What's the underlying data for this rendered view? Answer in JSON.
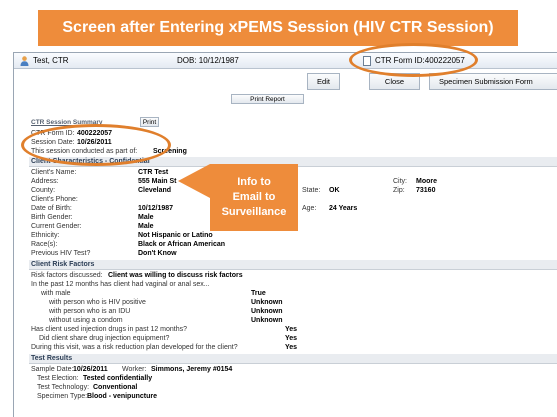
{
  "banner": {
    "title": "Screen after Entering xPEMS Session (HIV CTR Session)"
  },
  "titlebar": {
    "name": "Test, CTR",
    "dob": "DOB: 10/12/1987",
    "form_id": "CTR Form ID:400222057"
  },
  "toolbar": {
    "edit": "Edit",
    "close": "Close",
    "specimen": "Specimen Submission Form",
    "print_report": "Print Report",
    "print": "Print"
  },
  "summary": {
    "title": "CTR Session Summary",
    "form_id_label": "CTR Form ID:",
    "form_id_value": "400222057",
    "session_date_label": "Session Date:",
    "session_date_value": "10/26/2011",
    "conducted_label": "This session conducted as part of:",
    "conducted_value": "Screening"
  },
  "callout": {
    "line1": "Info to",
    "line2": "Email to",
    "line3": "Surveillance"
  },
  "client": {
    "header": "Client Characteristics - Confidential",
    "name_label": "Client's Name:",
    "name": "CTR Test",
    "address_label": "Address:",
    "address": "555 Main St",
    "city_label": "City:",
    "city": "Moore",
    "county_label": "County:",
    "county": "Cleveland",
    "state_label": "State:",
    "state": "OK",
    "zip_label": "Zip:",
    "zip": "73160",
    "phone_label": "Client's Phone:",
    "dob_label": "Date of Birth:",
    "dob": "10/12/1987",
    "age_label": "Age:",
    "age": "24 Years",
    "birth_gender_label": "Birth Gender:",
    "birth_gender": "Male",
    "current_gender_label": "Current Gender:",
    "current_gender": "Male",
    "ethnicity_label": "Ethnicity:",
    "ethnicity": "Not Hispanic or Latino",
    "race_label": "Race(s):",
    "race": "Black or African American",
    "prev_test_label": "Previous HIV Test?",
    "prev_test": "Don't Know"
  },
  "risk": {
    "header": "Client Risk Factors",
    "discussed_label": "Risk factors discussed:",
    "discussed": "Client was willing to discuss risk factors",
    "past12": "In the past 12 months has client had vaginal or anal sex...",
    "with_male": "with male",
    "with_male_val": "True",
    "hiv_pos": "with person who is HIV positive",
    "hiv_pos_val": "Unknown",
    "idu": "with person who is an IDU",
    "idu_val": "Unknown",
    "condom": "without using a condom",
    "condom_val": "Unknown",
    "inj": "Has client used injection drugs in past 12 months?",
    "inj_val": "Yes",
    "share": "Did client share drug injection equipment?",
    "share_val": "Yes",
    "plan": "During this visit, was a risk reduction plan developed for the client?",
    "plan_val": "Yes"
  },
  "results": {
    "header": "Test Results",
    "sample_date_label": "Sample Date:",
    "sample_date": "10/26/2011",
    "worker_label": "Worker:",
    "worker": "Simmons, Jeremy #0154",
    "election_label": "Test Election:",
    "election": "Tested confidentially",
    "technology_label": "Test Technology:",
    "technology": "Conventional",
    "specimen_label": "Specimen Type:",
    "specimen": "Blood - venipuncture"
  },
  "colors": {
    "accent": "#ee8c3b",
    "ring": "#e07f2c"
  }
}
